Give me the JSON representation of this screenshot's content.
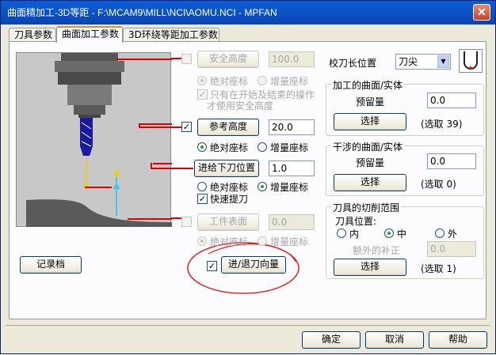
{
  "window": {
    "title": "曲面精加工-3D等距 - F:\\MCAM9\\MILL\\NCI\\AOMU.NCI - MPFAN",
    "close_glyph": "✕"
  },
  "tabs": [
    "刀具参数",
    "曲面加工参数",
    "3D环绕等距加工参数"
  ],
  "left": {
    "safe_height": {
      "label": "安全高度",
      "value": "100.0",
      "checked": false,
      "enabled": false
    },
    "safe_coords": {
      "abs": "绝对座标",
      "inc": "增量座标"
    },
    "safe_only": {
      "line1": "只有在开始及结束的操作",
      "line2": "才使用安全高度"
    },
    "ref_height": {
      "label": "参考高度",
      "value": "20.0",
      "checked": true
    },
    "ref_coords": {
      "abs": "绝对座标",
      "inc": "增量座标"
    },
    "feed_plane": {
      "label": "进给下刀位置",
      "value": "1.0"
    },
    "feed_coords": {
      "abs": "绝对座标",
      "inc": "增量座标"
    },
    "fast_retract": {
      "label": "快速提刀",
      "checked": true
    },
    "work_surface": {
      "label": "工件表面",
      "value": "0.0",
      "checked": false,
      "enabled": false
    },
    "work_coords": {
      "abs": "绝对座标",
      "inc": "增量座标"
    },
    "record_button": "记录档",
    "lead_button": {
      "label": "进/退刀向量",
      "checked": true
    }
  },
  "right": {
    "tip_position": {
      "label": "校刀长位置",
      "value": "刀尖"
    },
    "drive_group": {
      "title": "加工的曲面/实体",
      "stock_label": "预留量",
      "stock_value": "0.0",
      "select": "选择",
      "count": "(选取 39)"
    },
    "check_group": {
      "title": "干涉的曲面/实体",
      "stock_label": "预留量",
      "stock_value": "0.0",
      "select": "选择",
      "count": "(选取 0)"
    },
    "boundary_group": {
      "title": "刀具的切削范围",
      "tool_pos": "刀具位置:",
      "inside": "内",
      "center": "中",
      "outside": "外",
      "extra_label": "额外的补正",
      "extra_value": "0.0",
      "select": "选择",
      "count": "(选取 1)"
    }
  },
  "footer": {
    "ok": "确定",
    "cancel": "取消",
    "help": "帮助"
  },
  "colors": {
    "titlebar": "#0a5fd8",
    "annotation": "#e02020",
    "leadline": "#e00000",
    "tool_blue": "#1a1aa0",
    "arrow_yellow": "#f0d000",
    "arrow_cyan": "#40c8e0"
  }
}
